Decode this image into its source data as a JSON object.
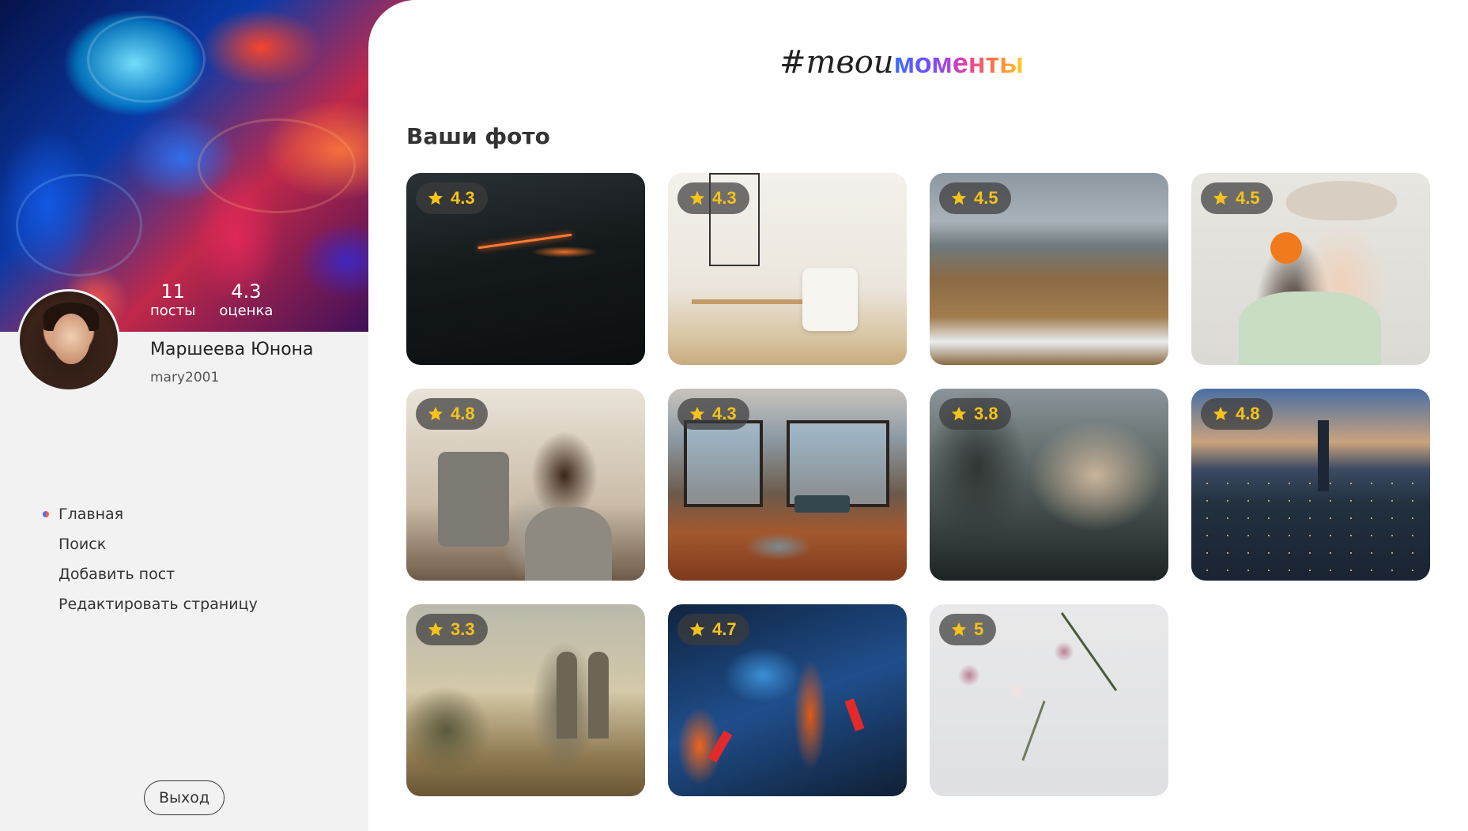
{
  "profile": {
    "posts_count": "11",
    "posts_label": "посты",
    "rating_value": "4.3",
    "rating_label": "оценка",
    "name": "Маршеева Юнона",
    "login": "mary2001"
  },
  "nav": {
    "items": [
      {
        "label": "Главная",
        "active": true
      },
      {
        "label": "Поиск",
        "active": false
      },
      {
        "label": "Добавить пост",
        "active": false
      },
      {
        "label": "Редактировать страницу",
        "active": false
      }
    ]
  },
  "logout_label": "Выход",
  "logo": {
    "hash_text": "#твои",
    "colored_text": "моменты"
  },
  "section_title": "Ваши фото",
  "photos": [
    {
      "rating": "4.3",
      "subject": "night-road"
    },
    {
      "rating": "4.3",
      "subject": "interior-chair"
    },
    {
      "rating": "4.5",
      "subject": "mountain-tundra"
    },
    {
      "rating": "4.5",
      "subject": "woman-hat-orange"
    },
    {
      "rating": "4.8",
      "subject": "father-baby"
    },
    {
      "rating": "4.3",
      "subject": "loft-room"
    },
    {
      "rating": "3.8",
      "subject": "coastal-town"
    },
    {
      "rating": "4.8",
      "subject": "city-skyline"
    },
    {
      "rating": "3.3",
      "subject": "classical-painting"
    },
    {
      "rating": "4.7",
      "subject": "abstract-painting"
    },
    {
      "rating": "5",
      "subject": "dried-flowers"
    }
  ],
  "colors": {
    "rating_text": "#f6c21c",
    "rating_pill": "#3c3c3c",
    "background": "#f2f2f2"
  }
}
